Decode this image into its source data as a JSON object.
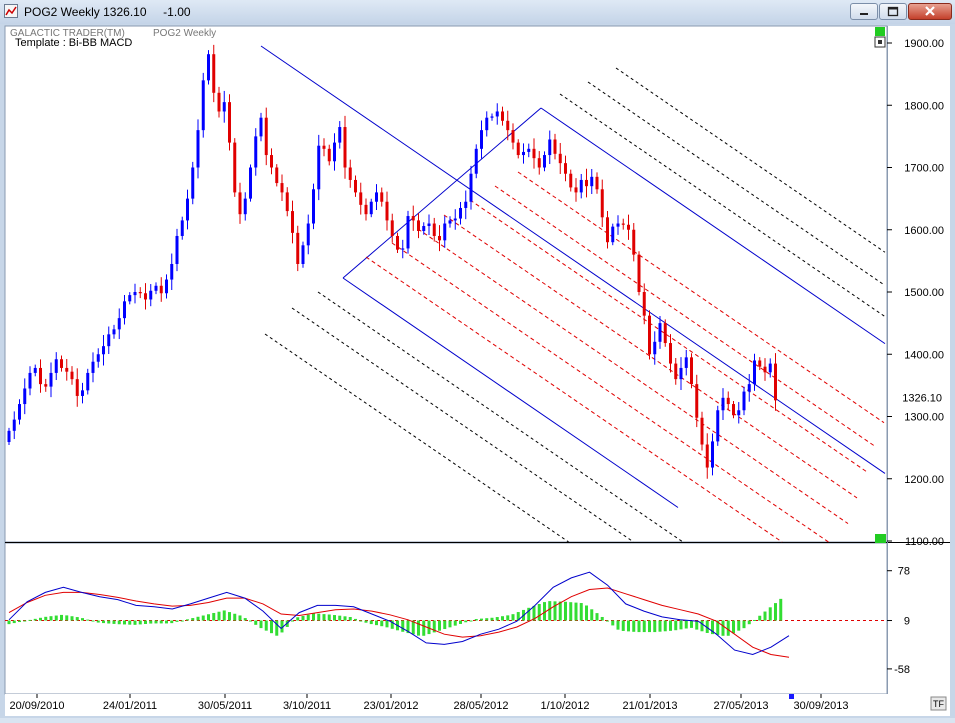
{
  "window": {
    "title": "POG2 Weekly 1326.10     -1.00",
    "minimize_icon": "minimize-icon",
    "maximize_icon": "maximize-icon",
    "close_icon": "close-icon"
  },
  "chart_header": {
    "brand": "GALACTIC TRADER(TM)",
    "symbol": "POG2 Weekly",
    "template": "Template : Bi-BB MACD"
  },
  "corner_badge": "TF",
  "colors": {
    "up": "#0000ff",
    "down": "#e00000",
    "pitchfork": "#0000cc",
    "red_lines": "#e00000",
    "black_lines": "#000000",
    "histogram": "#33dd33",
    "macd_line": "#0000cc",
    "signal_line": "#e00000"
  },
  "chart_data": [
    {
      "type": "candlestick",
      "title": "POG2 Weekly",
      "last_price_label": "1326.10",
      "ylim": [
        1100,
        1900
      ],
      "y_ticks": [
        "1900.00",
        "1800.00",
        "1700.00",
        "1600.00",
        "1500.00",
        "1400.00",
        "1300.00",
        "1200.00",
        "1100.00"
      ],
      "x_ticks": [
        "20/09/2010",
        "24/01/2011",
        "30/05/2011",
        "3/10/2011",
        "23/01/2012",
        "28/05/2012",
        "1/10/2012",
        "21/01/2013",
        "27/05/2013",
        "30/09/2013"
      ],
      "closes": [
        1277,
        1295,
        1320,
        1345,
        1370,
        1378,
        1352,
        1348,
        1370,
        1392,
        1378,
        1372,
        1360,
        1333,
        1342,
        1370,
        1388,
        1400,
        1413,
        1432,
        1440,
        1458,
        1485,
        1495,
        1500,
        1498,
        1488,
        1502,
        1510,
        1498,
        1520,
        1545,
        1590,
        1615,
        1650,
        1700,
        1760,
        1840,
        1882,
        1820,
        1790,
        1805,
        1740,
        1660,
        1625,
        1650,
        1700,
        1750,
        1780,
        1720,
        1700,
        1675,
        1660,
        1630,
        1595,
        1545,
        1575,
        1610,
        1665,
        1735,
        1730,
        1710,
        1740,
        1765,
        1700,
        1680,
        1660,
        1640,
        1625,
        1645,
        1660,
        1645,
        1615,
        1590,
        1568,
        1570,
        1622,
        1615,
        1598,
        1606,
        1610,
        1590,
        1583,
        1610,
        1615,
        1618,
        1635,
        1645,
        1690,
        1730,
        1760,
        1780,
        1782,
        1790,
        1775,
        1760,
        1740,
        1720,
        1725,
        1730,
        1715,
        1700,
        1720,
        1745,
        1722,
        1707,
        1690,
        1668,
        1660,
        1680,
        1670,
        1685,
        1665,
        1620,
        1580,
        1605,
        1610,
        1608,
        1600,
        1560,
        1500,
        1462,
        1400,
        1420,
        1450,
        1418,
        1385,
        1360,
        1378,
        1395,
        1352,
        1298,
        1255,
        1218,
        1260,
        1310,
        1330,
        1320,
        1302,
        1310,
        1340,
        1352,
        1390,
        1380,
        1371,
        1385,
        1326
      ],
      "pitchfork": {
        "pivot_dates": [
          "Sep 2011",
          "Dec 2011",
          "Oct 2012"
        ],
        "pivot_prices": [
          1895,
          1525,
          1795
        ]
      }
    },
    {
      "type": "line",
      "title": "Bi-BB MACD",
      "y_ticks": [
        "78",
        "9",
        "-58"
      ],
      "zero_line": 9,
      "series": [
        {
          "role": "macd",
          "values": [
            10,
            35,
            48,
            55,
            48,
            42,
            38,
            30,
            28,
            25,
            32,
            40,
            48,
            40,
            22,
            -2,
            20,
            30,
            30,
            28,
            18,
            8,
            -6,
            -22,
            -24,
            -20,
            -10,
            -3,
            8,
            30,
            55,
            68,
            76,
            58,
            32,
            22,
            14,
            10,
            8,
            -10,
            -32,
            -38,
            -28,
            -12
          ]
        },
        {
          "role": "signal",
          "values": [
            20,
            34,
            44,
            48,
            48,
            45,
            41,
            36,
            32,
            29,
            30,
            34,
            40,
            40,
            32,
            18,
            16,
            20,
            24,
            25,
            22,
            17,
            10,
            0,
            -10,
            -14,
            -12,
            -7,
            0,
            12,
            28,
            42,
            52,
            54,
            46,
            38,
            30,
            24,
            18,
            8,
            -10,
            -28,
            -38,
            -42
          ]
        },
        {
          "role": "histogram",
          "values": [
            -5,
            0,
            5,
            8,
            4,
            -3,
            -5,
            -6,
            -4,
            -4,
            2,
            8,
            14,
            6,
            -10,
            -22,
            4,
            10,
            8,
            5,
            -4,
            -9,
            -16,
            -22,
            -14,
            -6,
            2,
            4,
            8,
            18,
            27,
            26,
            24,
            6,
            -14,
            -16,
            -16,
            -14,
            -10,
            -18,
            -22,
            -10,
            10,
            30
          ]
        }
      ]
    }
  ]
}
